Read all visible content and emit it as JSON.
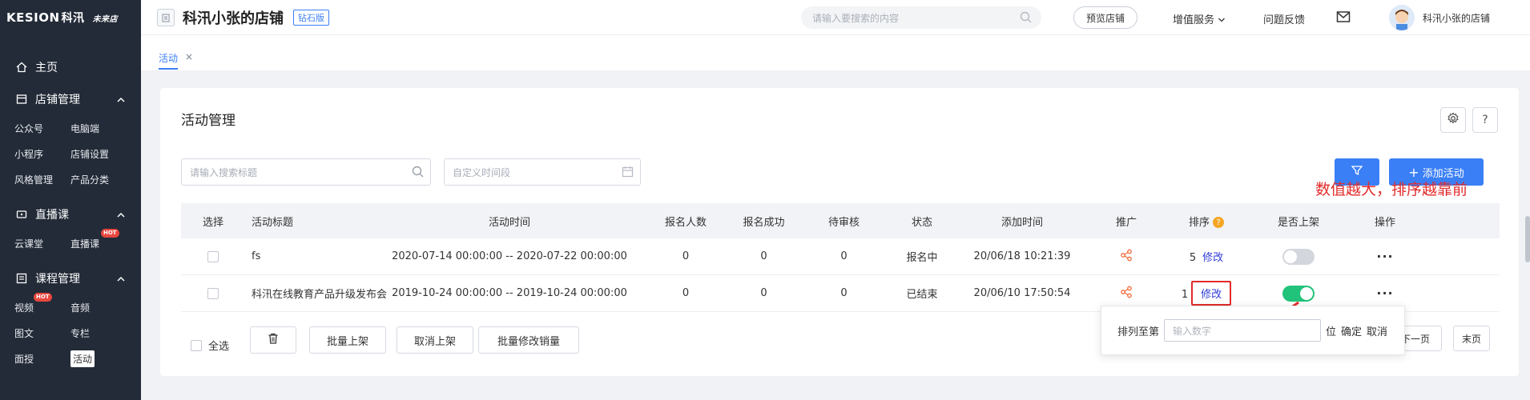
{
  "app": {
    "logo_brand": "KESION",
    "logo_cn": "科汛",
    "logo_tag": "未来店",
    "colors": {
      "sidebar_bg": "#232b38",
      "accent": "#3a7ff6",
      "annotation": "#e22b2b",
      "toggle_on": "#21c27a",
      "hot": "#e8473e"
    }
  },
  "sidebar": {
    "home": {
      "label": "主页",
      "icon": "home-icon"
    },
    "groups": [
      {
        "label": "店铺管理",
        "icon": "store-icon",
        "items": [
          {
            "label": "公众号"
          },
          {
            "label": "电脑端"
          },
          {
            "label": "小程序"
          },
          {
            "label": "店铺设置"
          },
          {
            "label": "风格管理"
          },
          {
            "label": "产品分类"
          }
        ]
      },
      {
        "label": "直播课",
        "icon": "live-icon",
        "items": [
          {
            "label": "云课堂"
          },
          {
            "label": "直播课",
            "badge": "HOT"
          }
        ]
      },
      {
        "label": "课程管理",
        "icon": "course-icon",
        "items": [
          {
            "label": "视频",
            "badge": "HOT"
          },
          {
            "label": "音频"
          },
          {
            "label": "图文"
          },
          {
            "label": "专栏"
          },
          {
            "label": "面授"
          },
          {
            "label": "活动",
            "active": true
          }
        ]
      }
    ]
  },
  "header": {
    "shop_name": "科汛小张的店铺",
    "edition": "钻石版",
    "search_placeholder": "请输入要搜索的内容",
    "preview_label": "预览店铺",
    "services_label": "增值服务",
    "feedback_label": "问题反馈",
    "user_name": "科汛小张的店铺"
  },
  "tabs": {
    "active_label": "活动",
    "close_glyph": "×"
  },
  "main": {
    "title": "活动管理",
    "search_placeholder": "请输入搜索标题",
    "date_placeholder": "自定义时间段",
    "add_label": "添加活动",
    "annotation": "数值越大，排序越靠前",
    "columns": [
      "选择",
      "活动标题",
      "活动时间",
      "报名人数",
      "报名成功",
      "待审核",
      "状态",
      "添加时间",
      "推广",
      "排序",
      "是否上架",
      "操作"
    ],
    "rows": [
      {
        "title": "fs",
        "time": "2020-07-14 00:00:00 -- 2020-07-22 00:00:00",
        "signups": "0",
        "success": "0",
        "pending": "0",
        "status": "报名中",
        "added": "20/06/18 10:21:39",
        "rank": "5",
        "edit": "修改",
        "on_shelf": false,
        "ops": "···"
      },
      {
        "title": "科汛在线教育产品升级发布会",
        "time": "2019-10-24 00:00:00 -- 2019-10-24 00:00:00",
        "signups": "0",
        "success": "0",
        "pending": "0",
        "status": "已结束",
        "added": "20/06/10 17:50:54",
        "rank": "1",
        "edit": "修改",
        "on_shelf": true,
        "ops": "···"
      }
    ],
    "footer": {
      "select_all": "全选",
      "batch_on": "批量上架",
      "cancel_on": "取消上架",
      "batch_sales": "批量修改销量"
    },
    "popover": {
      "prefix": "排列至第",
      "input_placeholder": "输入数字",
      "suffix": "位",
      "confirm": "确定",
      "cancel": "取消"
    },
    "pager": {
      "next": "下一页",
      "last": "末页"
    }
  }
}
